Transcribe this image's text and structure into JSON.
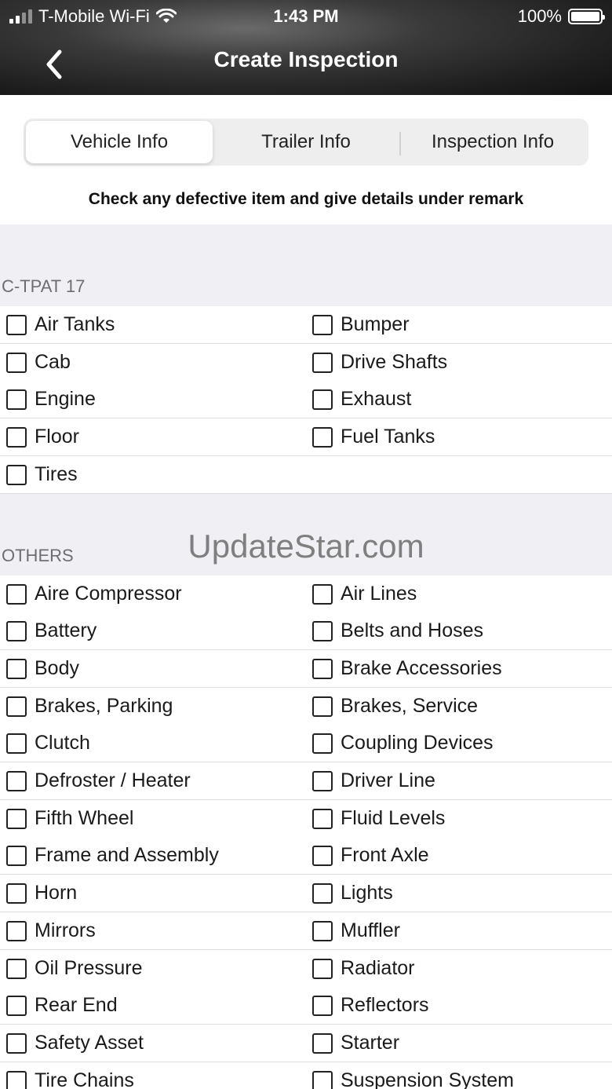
{
  "status_bar": {
    "carrier": "T-Mobile Wi-Fi",
    "time": "1:43 PM",
    "battery": "100%"
  },
  "nav": {
    "title": "Create Inspection"
  },
  "tabs": [
    {
      "label": "Vehicle Info",
      "active": true
    },
    {
      "label": "Trailer Info",
      "active": false
    },
    {
      "label": "Inspection Info",
      "active": false
    }
  ],
  "instruction": "Check any defective item and give details under remark",
  "sections": [
    {
      "title": "C-TPAT 17",
      "rows": [
        [
          "Air Tanks",
          "Bumper"
        ],
        [
          "Cab",
          "Drive Shafts"
        ],
        [
          "Engine",
          "Exhaust"
        ],
        [
          "Floor",
          "Fuel Tanks"
        ],
        [
          "Tires",
          ""
        ]
      ]
    },
    {
      "title": "OTHERS",
      "rows": [
        [
          "Aire Compressor",
          "Air Lines"
        ],
        [
          "Battery",
          "Belts and Hoses"
        ],
        [
          "Body",
          "Brake Accessories"
        ],
        [
          "Brakes, Parking",
          "Brakes, Service"
        ],
        [
          "Clutch",
          "Coupling Devices"
        ],
        [
          "Defroster / Heater",
          "Driver Line"
        ],
        [
          "Fifth Wheel",
          "Fluid Levels"
        ],
        [
          "Frame and Assembly",
          "Front Axle"
        ],
        [
          "Horn",
          "Lights"
        ],
        [
          "Mirrors",
          "Muffler"
        ],
        [
          "Oil Pressure",
          "Radiator"
        ],
        [
          "Rear End",
          "Reflectors"
        ],
        [
          "Safety Asset",
          "Starter"
        ],
        [
          "Tire Chains",
          "Suspension System"
        ]
      ]
    }
  ],
  "watermark": "UpdateStar.com"
}
